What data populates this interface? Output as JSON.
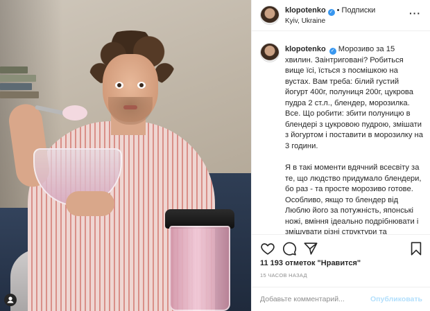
{
  "post": {
    "username": "klopotenko",
    "follow_label": "Подписки",
    "location": "Kyiv, Ukraine",
    "caption_paragraphs": [
      "Морозиво за 15 хвилин. Заінтриговані? Робиться вище їсі, їсться з посмішкою на вустах. Вам треба: білий густий йогурт 400г, полуниця 200г, цукрова пудра 2 ст.л., блендер, морозилка. Все. Що робити: збити полуницю в блендері з цукровою пудрою, змішати з йогуртом і поставити в морозилку на 3 години.",
      "Я в такі моменти вдячний всесвіту за те, що людство придумало блендери, бо раз - та просте морозиво готове. Особливо, якщо то блендер від",
      "Люблю його за потужність, японські ножі, вміння ідеально подрібнювати і змішувати різні структури та"
    ],
    "likes": "11 193 отметок \"Нравится\"",
    "time": "15 ЧАСОВ НАЗАД",
    "comment_placeholder": "Добавьте комментарий...",
    "publish_label": "Опубликовать"
  },
  "icons": {
    "verified": "verified-badge-icon",
    "more": "more-options-icon",
    "like": "heart-icon",
    "comment": "comment-icon",
    "share": "share-icon",
    "save": "bookmark-icon",
    "tag": "user-tag-icon"
  },
  "colors": {
    "accent": "#3897f0",
    "publish_disabled": "#b2dffc",
    "muted": "#8e8e8e",
    "border": "#efefef"
  }
}
